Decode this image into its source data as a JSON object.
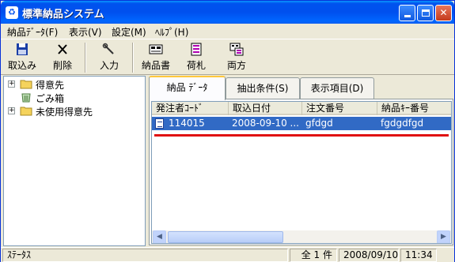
{
  "window": {
    "title": "標準納品システム",
    "icon": "app-icon"
  },
  "menu": [
    {
      "label": "納品ﾃﾞｰﾀ(F)"
    },
    {
      "label": "表示(V)"
    },
    {
      "label": "設定(M)"
    },
    {
      "label": "ﾍﾙﾌﾟ(H)"
    }
  ],
  "toolbar": [
    {
      "label": "取込み",
      "icon": "floppy-disk-icon"
    },
    {
      "label": "削除",
      "icon": "delete-x-icon"
    },
    {
      "label": "入力",
      "icon": "wrench-icon"
    },
    {
      "label": "納品書",
      "icon": "invoice-icon"
    },
    {
      "label": "荷札",
      "icon": "tag-icon"
    },
    {
      "label": "両方",
      "icon": "both-icon"
    }
  ],
  "tree": {
    "items": [
      {
        "label": "得意先",
        "expander": "+"
      },
      {
        "label": "ごみ箱",
        "expander": ""
      },
      {
        "label": "未使用得意先",
        "expander": "+"
      }
    ]
  },
  "tabs": [
    {
      "label": "納品 ﾃﾞｰﾀ",
      "active": true
    },
    {
      "label": "抽出条件(S)",
      "active": false
    },
    {
      "label": "表示項目(D)",
      "active": false
    }
  ],
  "list": {
    "columns": [
      "発注者ｺｰﾄﾞ",
      "取込日付",
      "注文番号",
      "納品ｷｰ番号"
    ],
    "rows": [
      {
        "cells": [
          "114015",
          "2008-09-10 ...",
          "gfdgd",
          "fgdgdfgd"
        ]
      }
    ]
  },
  "statusbar": {
    "status": "ｽﾃｰﾀｽ",
    "count": "全 1 件",
    "date": "2008/09/10",
    "time": "11:34"
  },
  "colors": {
    "selection": "#316ac5",
    "titlebar": "#0050ee",
    "highlight_line": "#e01010"
  }
}
